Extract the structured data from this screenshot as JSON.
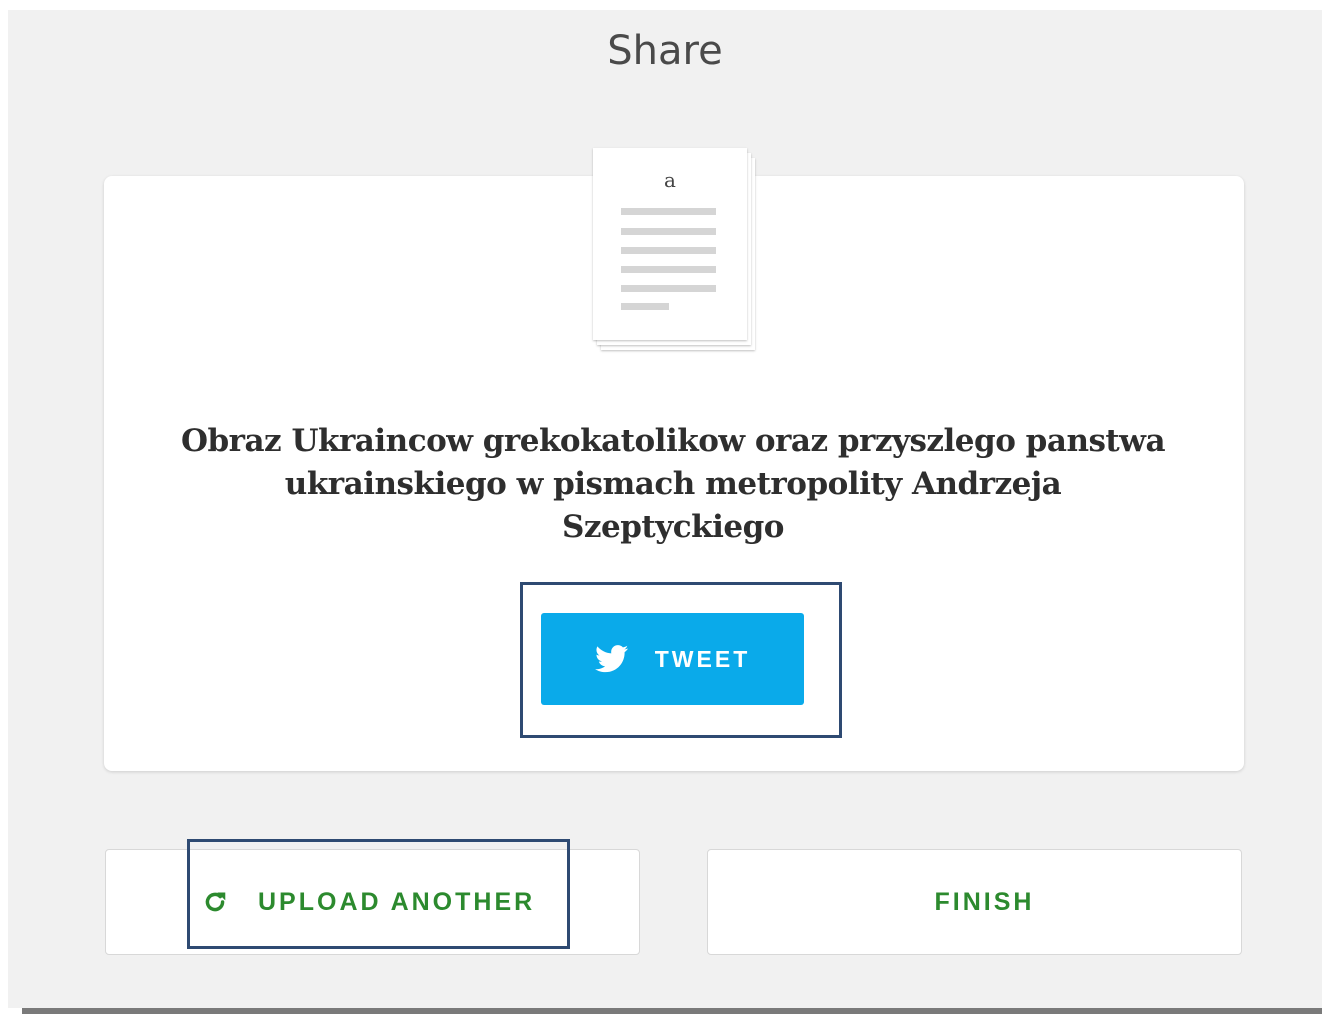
{
  "header": {
    "title": "Share"
  },
  "document": {
    "thumbnail_letter": "a",
    "title": "Obraz Ukraincow grekokatolikow oraz przyszlego panstwa ukrainskiego w pismach metropolity Andrzeja Szeptyckiego"
  },
  "share": {
    "tweet_label": "TWEET",
    "tweet_icon": "twitter-bird-icon",
    "tweet_color": "#0aaaea"
  },
  "actions": {
    "upload_another_label": "UPLOAD ANOTHER",
    "upload_icon": "refresh-icon",
    "finish_label": "FINISH",
    "accent_color": "#2c8a2e"
  }
}
